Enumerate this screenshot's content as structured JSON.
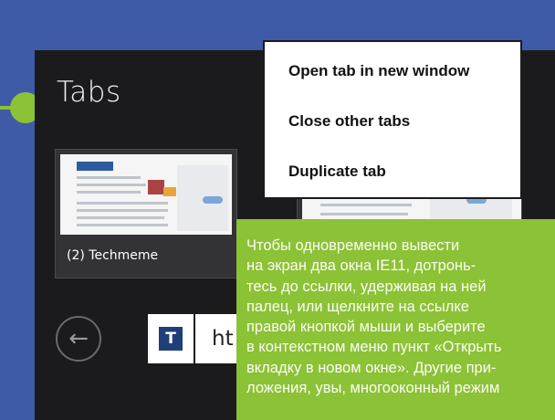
{
  "panel": {
    "title": "Tabs"
  },
  "tabs": [
    {
      "label": "(2) Techmeme"
    },
    {
      "label": ""
    }
  ],
  "context_menu": {
    "items": [
      {
        "label": "Open tab in new window"
      },
      {
        "label": "Close other tabs"
      },
      {
        "label": "Duplicate tab"
      }
    ]
  },
  "address_bar": {
    "text": "ht",
    "site_icon": "T"
  },
  "icons": {
    "back": "back-arrow-icon",
    "site": "techmeme-site-icon"
  },
  "caption": {
    "text": "Чтобы одновременно вывести\nна экран два окна IE11, дотронь-\nтесь до ссылки, удерживая на ней\nпалец, или щелкните на ссылке\nправой кнопкой мыши и выберите\nв контекстном меню пункт «Открыть\nвкладку в новом окне». Другие при-\nложения, увы, многооконный режим"
  },
  "colors": {
    "accent_green": "#8cc236",
    "page_blue": "#3f5aa7",
    "panel_dark": "#1b1b1d"
  }
}
